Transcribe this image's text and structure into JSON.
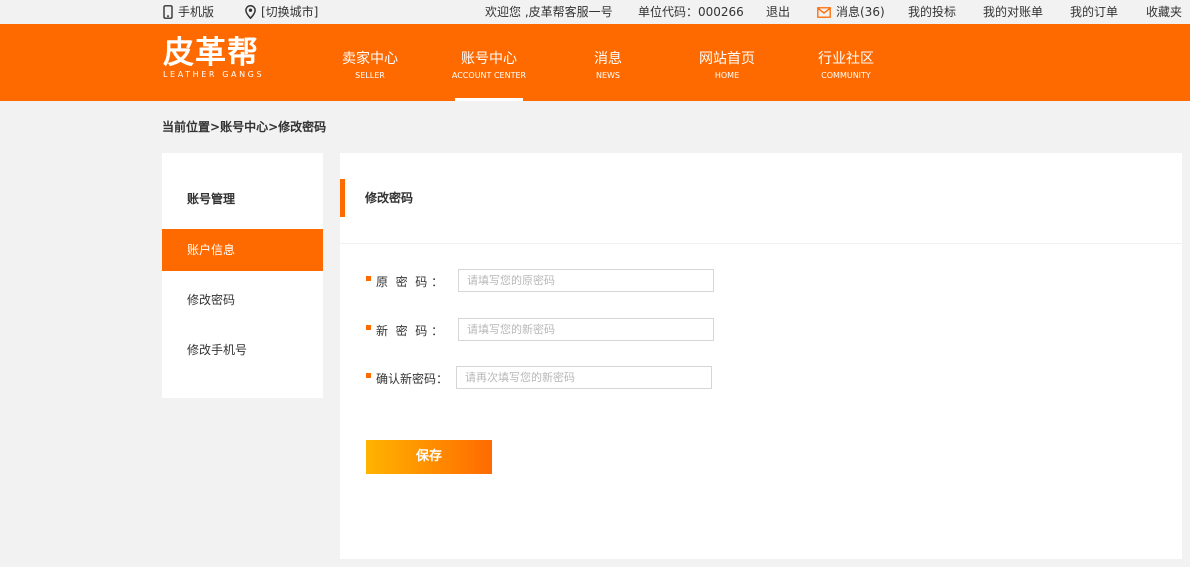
{
  "topbar": {
    "mobile_label": "手机版",
    "city_label": "[切换城市]",
    "welcome": "欢迎您 ,皮革帮客服一号",
    "unit_code": "单位代码：000266",
    "logout": "退出",
    "messages": "消息(36)",
    "my_complaints": "我的投标",
    "my_statements": "我的对账单",
    "my_orders": "我的订单",
    "favorites": "收藏夹"
  },
  "logo": {
    "cn": "皮革帮",
    "en": "LEATHER GANGS"
  },
  "nav": {
    "items": [
      {
        "cn": "卖家中心",
        "en": "SELLER"
      },
      {
        "cn": "账号中心",
        "en": "ACCOUNT CENTER"
      },
      {
        "cn": "消息",
        "en": "NEWS"
      },
      {
        "cn": "网站首页",
        "en": "HOME"
      },
      {
        "cn": "行业社区",
        "en": "COMMUNITY"
      }
    ],
    "active_index": 1
  },
  "breadcrumb": {
    "prefix": "当前位置>",
    "parent": "账号中心",
    "sep": ">",
    "current": "修改密码"
  },
  "sidebar": {
    "items": [
      {
        "label": "账号管理"
      },
      {
        "label": "账户信息"
      },
      {
        "label": "修改密码"
      },
      {
        "label": "修改手机号"
      }
    ],
    "active_index": 1
  },
  "main": {
    "title": "修改密码",
    "fields": [
      {
        "label": "原  密  码 ：",
        "placeholder": "请填写您的原密码",
        "value": ""
      },
      {
        "label": "新  密  码 ：",
        "placeholder": "请填写您的新密码",
        "value": ""
      },
      {
        "label": "确认新密码：",
        "placeholder": "请再次填写您的新密码",
        "value": ""
      }
    ],
    "save_label": "保存"
  },
  "colors": {
    "brand": "#ff6a00",
    "button_start": "#ffb400",
    "button_end": "#ff6a00",
    "background": "#f2f2f2"
  },
  "icons": {
    "mobile": "mobile-phone-icon",
    "city": "location-pin-icon",
    "message": "envelope-icon"
  }
}
